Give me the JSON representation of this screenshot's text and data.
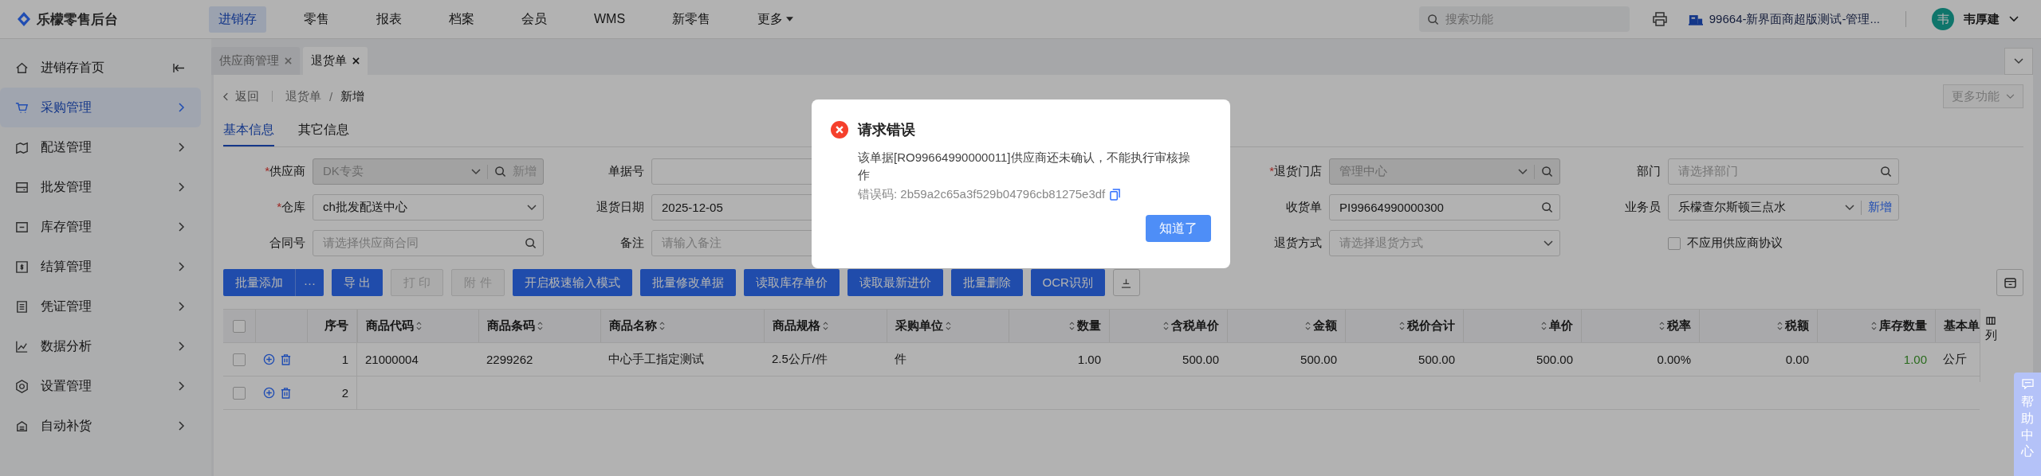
{
  "app": {
    "logo": "乐檬零售后台"
  },
  "nav": [
    {
      "label": "进销存",
      "selected": true,
      "dropdown": false
    },
    {
      "label": "零售",
      "selected": false,
      "dropdown": false
    },
    {
      "label": "报表",
      "selected": false,
      "dropdown": false
    },
    {
      "label": "档案",
      "selected": false,
      "dropdown": false
    },
    {
      "label": "会员",
      "selected": false,
      "dropdown": false
    },
    {
      "label": "WMS",
      "selected": false,
      "dropdown": false
    },
    {
      "label": "新零售",
      "selected": false,
      "dropdown": false
    },
    {
      "label": "更多",
      "selected": false,
      "dropdown": true
    }
  ],
  "search": {
    "placeholder": "搜索功能"
  },
  "store": "99664-新界面商超版测试-管理...",
  "user": {
    "avatar": "韦",
    "name": "韦厚建"
  },
  "sidebar": {
    "items": [
      {
        "label": "进销存首页",
        "selected": false
      },
      {
        "label": "采购管理",
        "selected": true
      },
      {
        "label": "配送管理",
        "selected": false
      },
      {
        "label": "批发管理",
        "selected": false
      },
      {
        "label": "库存管理",
        "selected": false
      },
      {
        "label": "结算管理",
        "selected": false
      },
      {
        "label": "凭证管理",
        "selected": false
      },
      {
        "label": "数据分析",
        "selected": false
      },
      {
        "label": "设置管理",
        "selected": false
      },
      {
        "label": "自动补货",
        "selected": false
      }
    ]
  },
  "tabs": [
    {
      "label": "供应商管理",
      "selected": false
    },
    {
      "label": "退货单",
      "selected": true
    }
  ],
  "breadcrumb": {
    "back": "返回",
    "separator": "/",
    "path": [
      "退货单",
      "新增"
    ]
  },
  "more_button": {
    "label": "更多功能",
    "disabled": true
  },
  "subtabs": [
    {
      "label": "基本信息",
      "selected": true
    },
    {
      "label": "其它信息",
      "selected": false
    }
  ],
  "form": {
    "required_mark": "*",
    "rows": [
      [
        {
          "label": "供应商",
          "required": true,
          "kind": "select",
          "value": "DK专卖",
          "disabled": true,
          "search": true,
          "add": "新增",
          "add_disabled": true
        },
        {
          "label": "单据号",
          "required": false,
          "kind": "input"
        },
        {
          "label": "退货门店",
          "required": true,
          "kind": "select",
          "value": "管理中心",
          "disabled": true,
          "search": true
        },
        {
          "label": "部门",
          "required": false,
          "kind": "input",
          "placeholder": "请选择部门",
          "disabled": false,
          "search": true
        }
      ],
      [
        {
          "label": "仓库",
          "required": true,
          "kind": "select",
          "value": "ch批发配送中心",
          "disabled": false,
          "search": false
        },
        {
          "label": "退货日期",
          "required": false,
          "kind": "input",
          "value": "2025-12-05"
        },
        {
          "label": "收货单",
          "required": false,
          "kind": "input",
          "value": "PI99664990000300",
          "disabled": false,
          "search": true
        },
        {
          "label": "业务员",
          "required": false,
          "kind": "select",
          "value": "乐檬查尔斯顿三点水",
          "disabled": false,
          "search": false,
          "add": "新增",
          "add_disabled": false
        }
      ],
      [
        {
          "label": "合同号",
          "required": false,
          "kind": "input",
          "placeholder": "请选择供应商合同",
          "disabled": false,
          "search": true
        },
        {
          "label": "备注",
          "required": false,
          "kind": "input",
          "placeholder": "请输入备注"
        },
        {
          "label": "退货方式",
          "required": false,
          "kind": "select",
          "placeholder": "请选择退货方式",
          "disabled": false,
          "search": false
        },
        {
          "label": "不应用供应商协议",
          "kind": "checkbox",
          "checked": false
        }
      ]
    ]
  },
  "toolbar": [
    {
      "label": "批量添加",
      "kind": "split",
      "more": "···",
      "disabled": false
    },
    {
      "label": "导 出",
      "kind": "button",
      "disabled": false
    },
    {
      "label": "打 印",
      "kind": "button",
      "disabled": true
    },
    {
      "label": "附 件",
      "kind": "button",
      "disabled": true
    },
    {
      "label": "开启极速输入模式",
      "kind": "button",
      "disabled": false
    },
    {
      "label": "批量修改单据",
      "kind": "button",
      "disabled": false
    },
    {
      "label": "读取库存单价",
      "kind": "button",
      "disabled": false
    },
    {
      "label": "读取最新进价",
      "kind": "button",
      "disabled": false
    },
    {
      "label": "批量删除",
      "kind": "button",
      "disabled": false
    },
    {
      "label": "OCR识别",
      "kind": "button",
      "disabled": false
    }
  ],
  "table": {
    "header_checked": false,
    "columns": [
      {
        "label": "序号",
        "kind": "seq",
        "sortable": false
      },
      {
        "label": "商品代码",
        "kind": "text",
        "sortable": true
      },
      {
        "label": "商品条码",
        "kind": "text",
        "sortable": true
      },
      {
        "label": "商品名称",
        "kind": "text",
        "sortable": true
      },
      {
        "label": "商品规格",
        "kind": "text",
        "sortable": true
      },
      {
        "label": "采购单位",
        "kind": "text",
        "sortable": true
      },
      {
        "label": "数量",
        "kind": "number",
        "sortable": true
      },
      {
        "label": "含税单价",
        "kind": "number",
        "sortable": true
      },
      {
        "label": "金额",
        "kind": "number",
        "sortable": true
      },
      {
        "label": "税价合计",
        "kind": "number",
        "sortable": true
      },
      {
        "label": "单价",
        "kind": "number",
        "sortable": true
      },
      {
        "label": "税率",
        "kind": "number",
        "sortable": true
      },
      {
        "label": "税额",
        "kind": "number",
        "sortable": true
      },
      {
        "label": "库存数量",
        "kind": "stock",
        "sortable": true
      },
      {
        "label": "基本单",
        "kind": "text",
        "sortable": false
      }
    ],
    "rows": [
      {
        "checked": false,
        "cells": [
          "1",
          "21000004",
          "2299262",
          "中心手工指定测试",
          "2.5公斤/件",
          "件",
          "1.00",
          "500.00",
          "500.00",
          "500.00",
          "500.00",
          "0.00%",
          "0.00",
          "1.00",
          "公斤"
        ]
      },
      {
        "checked": false,
        "cells": [
          "2"
        ]
      }
    ],
    "settings": "列"
  },
  "dialog": {
    "title": "请求错误",
    "message": "该单据[RO99664990000011]供应商还未确认，不能执行审核操作",
    "code": "错误码: 2b59a2c65a3f529b04796cb81275e3df",
    "button": "知道了"
  },
  "help": "帮助中心"
}
